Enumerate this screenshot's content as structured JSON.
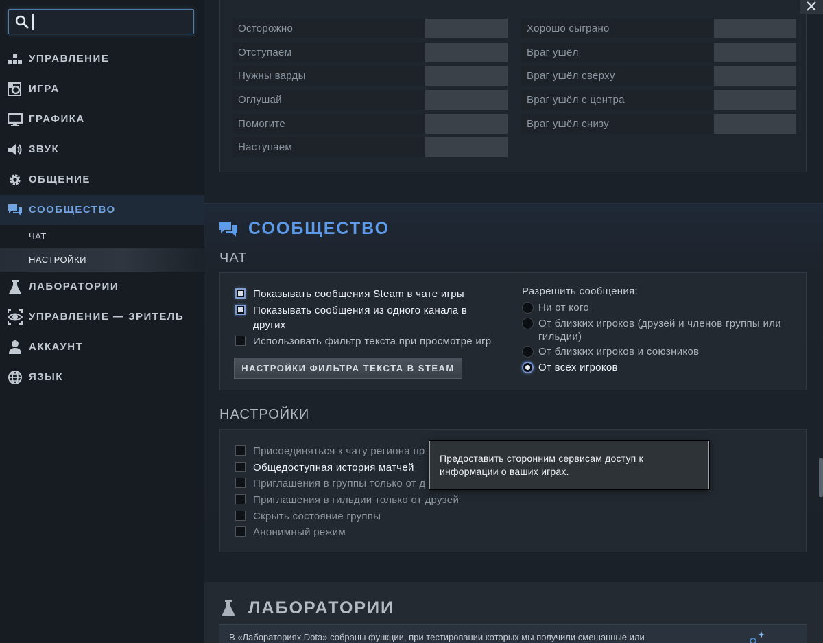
{
  "sidebar": {
    "search_value": "",
    "items": [
      {
        "label": "УПРАВЛЕНИЕ",
        "icon": "controls-icon"
      },
      {
        "label": "ИГРА",
        "icon": "game-icon"
      },
      {
        "label": "ГРАФИКА",
        "icon": "monitor-icon"
      },
      {
        "label": "ЗВУК",
        "icon": "speaker-icon"
      },
      {
        "label": "ОБЩЕНИЕ",
        "icon": "gear-icon"
      },
      {
        "label": "СООБЩЕСТВО",
        "icon": "chat-bubbles-icon",
        "active": true
      },
      {
        "label": "ЛАБОРАТОРИИ",
        "icon": "flask-icon"
      },
      {
        "label": "УПРАВЛЕНИЕ — ЗРИТЕЛЬ",
        "icon": "eye-icon"
      },
      {
        "label": "АККАУНТ",
        "icon": "user-icon"
      },
      {
        "label": "ЯЗЫК",
        "icon": "globe-icon"
      }
    ],
    "subitems": [
      {
        "label": "ЧАТ"
      },
      {
        "label": "НАСТРОЙКИ",
        "selected": true
      }
    ]
  },
  "chat_wheel": {
    "left": [
      "Осторожно",
      "Отступаем",
      "Нужны варды",
      "Оглушай",
      "Помогите",
      "Наступаем"
    ],
    "right": [
      "Хорошо сыграно",
      "Враг ушёл",
      "Враг ушёл сверху",
      "Враг ушёл с центра",
      "Враг ушёл снизу"
    ]
  },
  "community": {
    "title": "СООБЩЕСТВО",
    "chat_heading": "ЧАТ",
    "chat_options": [
      {
        "label": "Показывать сообщения Steam в чате игры",
        "checked": true
      },
      {
        "label": "Показывать сообщения из одного канала в других",
        "checked": true
      },
      {
        "label": "Использовать фильтр текста при просмотре игр",
        "checked": false
      }
    ],
    "filter_button": "НАСТРОЙКИ ФИЛЬТРА ТЕКСТА В STEAM",
    "allow_label": "Разрешить сообщения:",
    "allow_options": [
      {
        "label": "Ни от кого",
        "selected": false
      },
      {
        "label": "От близких игроков (друзей и членов группы или гильдии)",
        "selected": false
      },
      {
        "label": "От близких игроков и союзников",
        "selected": false
      },
      {
        "label": "От всех игроков",
        "selected": true
      }
    ],
    "settings_heading": "НАСТРОЙКИ",
    "settings_options": [
      {
        "label": "Присоединяться к чату региона пр",
        "checked": false
      },
      {
        "label": "Общедоступная история матчей",
        "checked": false,
        "hover": true
      },
      {
        "label": "Приглашения в группы только от д",
        "checked": false
      },
      {
        "label": "Приглашения в гильдии только от друзей",
        "checked": false
      },
      {
        "label": "Скрыть состояние группы",
        "checked": false
      },
      {
        "label": "Анонимный режим",
        "checked": false
      }
    ],
    "tooltip": "Предоставить сторонним сервисам доступ к информации о ваших играх."
  },
  "labs": {
    "title": "ЛАБОРАТОРИИ",
    "text": "В «Лабораториях Dota» собраны функции, при тестировании которых мы получили смешанные или"
  },
  "colors": {
    "accent": "#6fa4e0",
    "community_title": "#5d9ae8"
  }
}
